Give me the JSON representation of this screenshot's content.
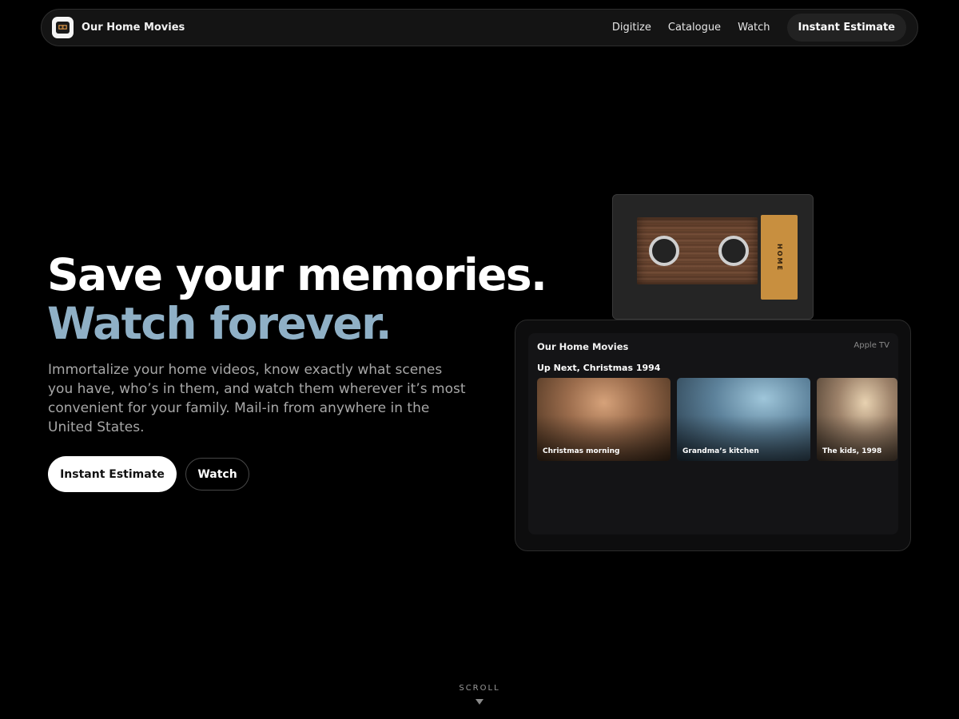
{
  "nav": {
    "brand": "Our Home Movies",
    "links": [
      "Digitize",
      "Catalogue",
      "Watch"
    ],
    "cta": "Instant Estimate"
  },
  "hero": {
    "title_line1": "Save your memories.",
    "title_line2": "Watch forever.",
    "description": "Immortalize your home videos, know exactly what scenes you have, who’s in them, and watch them wherever it’s most convenient for your family. Mail-in from anywhere in the United States.",
    "primary_button": "Instant Estimate",
    "secondary_button": "Watch"
  },
  "cassette": {
    "label": "HOME"
  },
  "tv": {
    "app_name": "Our Home Movies",
    "platform": "Apple TV",
    "up_next": "Up Next, Christmas 1994",
    "thumbnails": [
      {
        "label": "Christmas morning"
      },
      {
        "label": "Grandma’s kitchen"
      },
      {
        "label": "The kids, 1998"
      }
    ]
  },
  "scroll": {
    "label": "SCROLL"
  },
  "colors": {
    "background": "#000000",
    "accent_title": "#8fb0c6",
    "cassette_label": "#c88f3f"
  },
  "icons": [
    "cassette-logo-icon",
    "scroll-down-arrow-icon"
  ]
}
